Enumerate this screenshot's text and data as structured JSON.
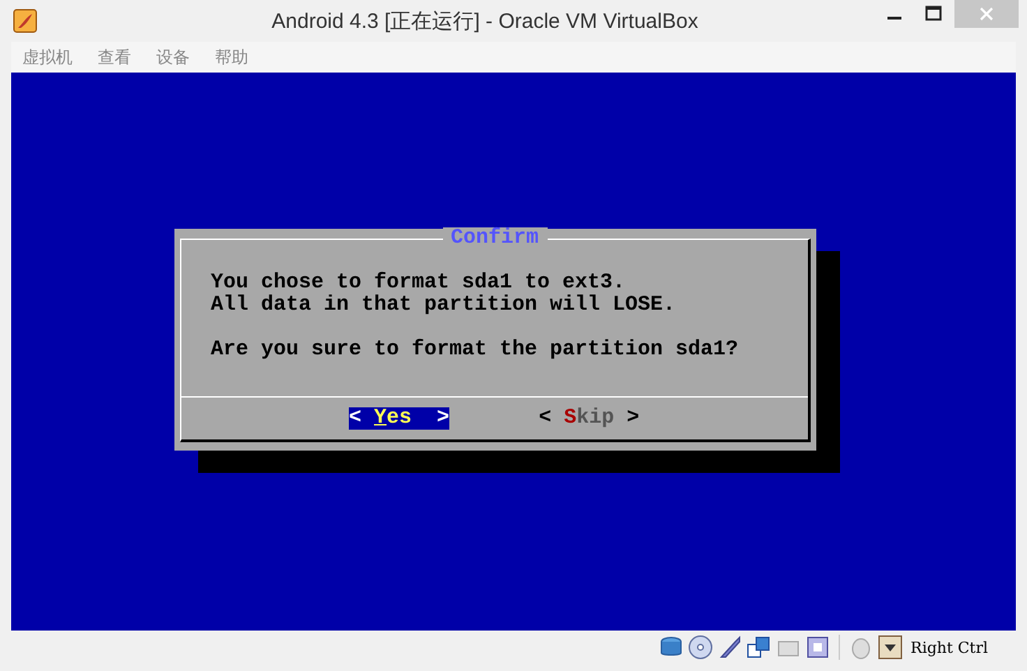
{
  "window": {
    "title": "Android 4.3 [正在运行] - Oracle VM VirtualBox"
  },
  "menu": [
    "虚拟机",
    "查看",
    "设备",
    "帮助"
  ],
  "dialog": {
    "title": "Confirm",
    "paragraphs": [
      [
        "You chose to format sda1 to ext3.",
        "All data in that partition will LOSE."
      ],
      [
        "Are you sure to format the partition sda1?"
      ]
    ],
    "buttons": [
      {
        "open": "<",
        "label": "Yes",
        "close": ">",
        "selected": true
      },
      {
        "open": "<",
        "label": "Skip",
        "close": ">",
        "selected": false
      }
    ]
  },
  "status_bar": {
    "host_key": "Right Ctrl"
  }
}
